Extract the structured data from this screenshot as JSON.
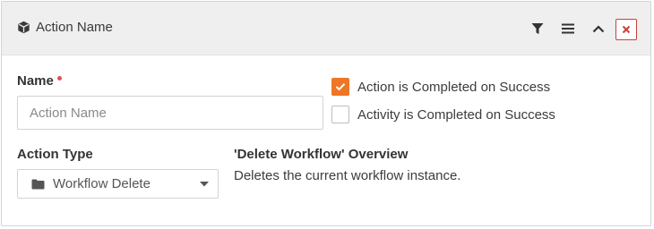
{
  "header": {
    "title": "Action Name",
    "icon": "cube-icon",
    "buttons": {
      "filter": "filter-icon",
      "menu": "menu-icon",
      "collapse": "chevron-up-icon",
      "close": "close-icon"
    }
  },
  "form": {
    "name_label": "Name",
    "name_required": true,
    "name_input": {
      "value": "",
      "placeholder": "Action Name"
    },
    "action_type_label": "Action Type",
    "action_type_select": {
      "selected": "Workflow Delete",
      "icon": "folder-icon"
    },
    "checkboxes": [
      {
        "label": "Action is Completed on Success",
        "checked": true
      },
      {
        "label": "Activity is Completed on Success",
        "checked": false
      }
    ],
    "overview": {
      "title": "'Delete Workflow' Overview",
      "description": "Deletes the current workflow instance."
    }
  },
  "colors": {
    "accent": "#ee7624",
    "required": "#d9534f",
    "close": "#c8413b",
    "header_bg": "#efefef"
  }
}
